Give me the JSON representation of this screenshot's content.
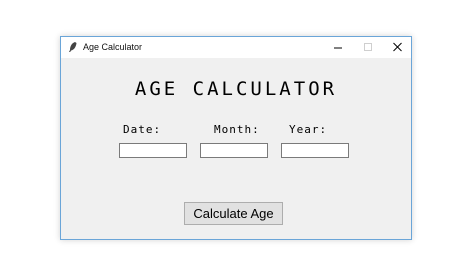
{
  "window": {
    "title": "Age Calculator",
    "app_icon": "feather-icon",
    "controls": {
      "minimize_icon": "minimize-icon",
      "maximize_icon": "maximize-icon",
      "close_icon": "close-icon"
    },
    "border_color": "#6aa5d8"
  },
  "main": {
    "heading": "AGE CALCULATOR",
    "labels": {
      "date": "Date:",
      "month": "Month:",
      "year": "Year:"
    },
    "inputs": {
      "date_value": "",
      "month_value": "",
      "year_value": ""
    },
    "button_label": "Calculate Age"
  },
  "colors": {
    "window_bg": "#f0f0f0",
    "titlebar_bg": "#ffffff",
    "button_bg": "#e1e1e1"
  }
}
